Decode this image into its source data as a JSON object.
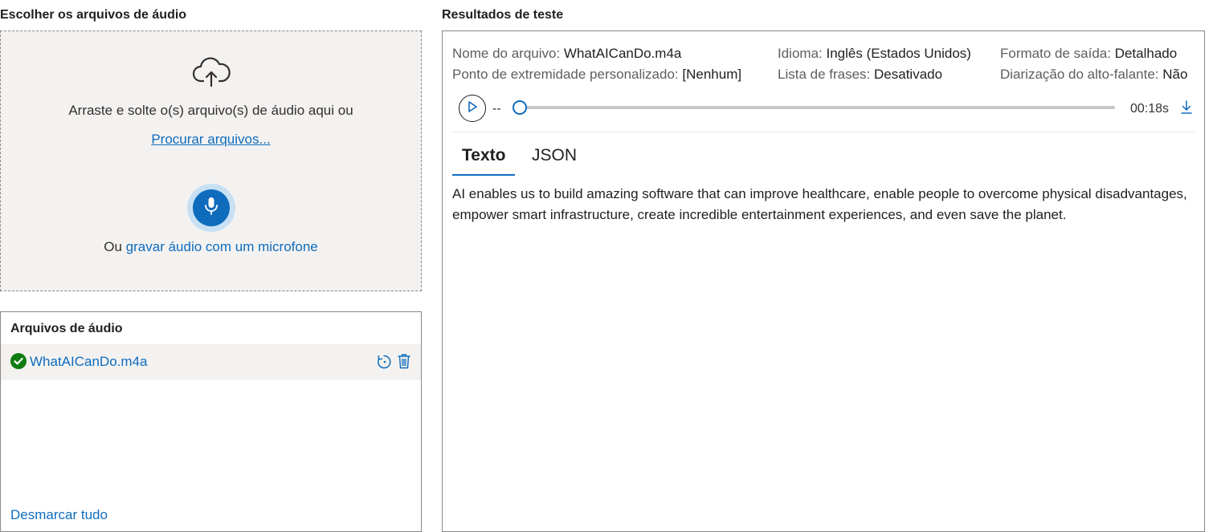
{
  "left": {
    "choose_title": "Escolher os arquivos de áudio",
    "drop_text": "Arraste e solte o(s) arquivo(s) de áudio aqui ou",
    "browse_link": "Procurar arquivos...",
    "record_prefix": "Ou",
    "record_link": "gravar áudio com um microfone"
  },
  "files": {
    "title": "Arquivos de áudio",
    "items": [
      {
        "name": "WhatAICanDo.m4a",
        "status": "success"
      }
    ],
    "deselect_all": "Desmarcar tudo"
  },
  "results": {
    "title": "Resultados de teste",
    "meta": {
      "file_label": "Nome do arquivo:",
      "file_value": "WhatAICanDo.m4a",
      "endpoint_label": "Ponto de extremidade personalizado:",
      "endpoint_value": "[Nenhum]",
      "language_label": "Idioma:",
      "language_value": "Inglês (Estados Unidos)",
      "phrase_label": "Lista de frases:",
      "phrase_value": "Desativado",
      "format_label": "Formato de saída:",
      "format_value": "Detalhado",
      "diarization_label": "Diarização do alto-falante:",
      "diarization_value": "Não"
    },
    "player": {
      "current_time": "--",
      "duration": "00:18s",
      "progress": 0
    },
    "tabs": [
      {
        "label": "Texto",
        "selected": true
      },
      {
        "label": "JSON",
        "selected": false
      }
    ],
    "transcript": "AI enables us to build amazing software that can improve healthcare, enable people to overcome physical disadvantages, empower smart infrastructure, create incredible entertainment experiences, and even save the planet."
  },
  "colors": {
    "accent": "#0f6cbd",
    "success": "#107c10",
    "panel_bg": "#f3f2f1"
  },
  "icons": {
    "upload": "cloud-upload-icon",
    "mic": "microphone-icon",
    "check": "check-circle-icon",
    "reprocess": "refresh-icon",
    "delete": "trash-icon",
    "play": "play-icon",
    "download": "download-icon"
  }
}
